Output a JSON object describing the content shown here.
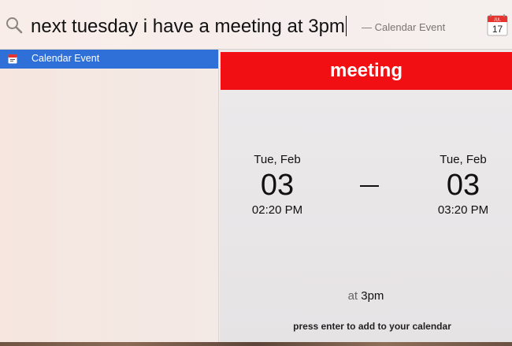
{
  "search": {
    "query": "next tuesday i have a meeting at 3pm",
    "hint": "— Calendar Event",
    "icon": "search-icon",
    "app_icon": {
      "name": "calendar-app-icon",
      "month": "JUL",
      "day": "17"
    }
  },
  "results": [
    {
      "label": "Calendar Event",
      "icon": "calendar-small-icon",
      "selected": true
    }
  ],
  "preview": {
    "title": "meeting",
    "start": {
      "date_label": "Tue, Feb",
      "day": "03",
      "time": "02:20 PM"
    },
    "separator": "–",
    "end": {
      "date_label": "Tue, Feb",
      "day": "03",
      "time": "03:20 PM"
    },
    "at_word": "at",
    "at_value": "3pm",
    "footer": "press enter to add to your calendar"
  },
  "colors": {
    "title_bar": "#f20f14",
    "selection": "#2f6fd8"
  }
}
